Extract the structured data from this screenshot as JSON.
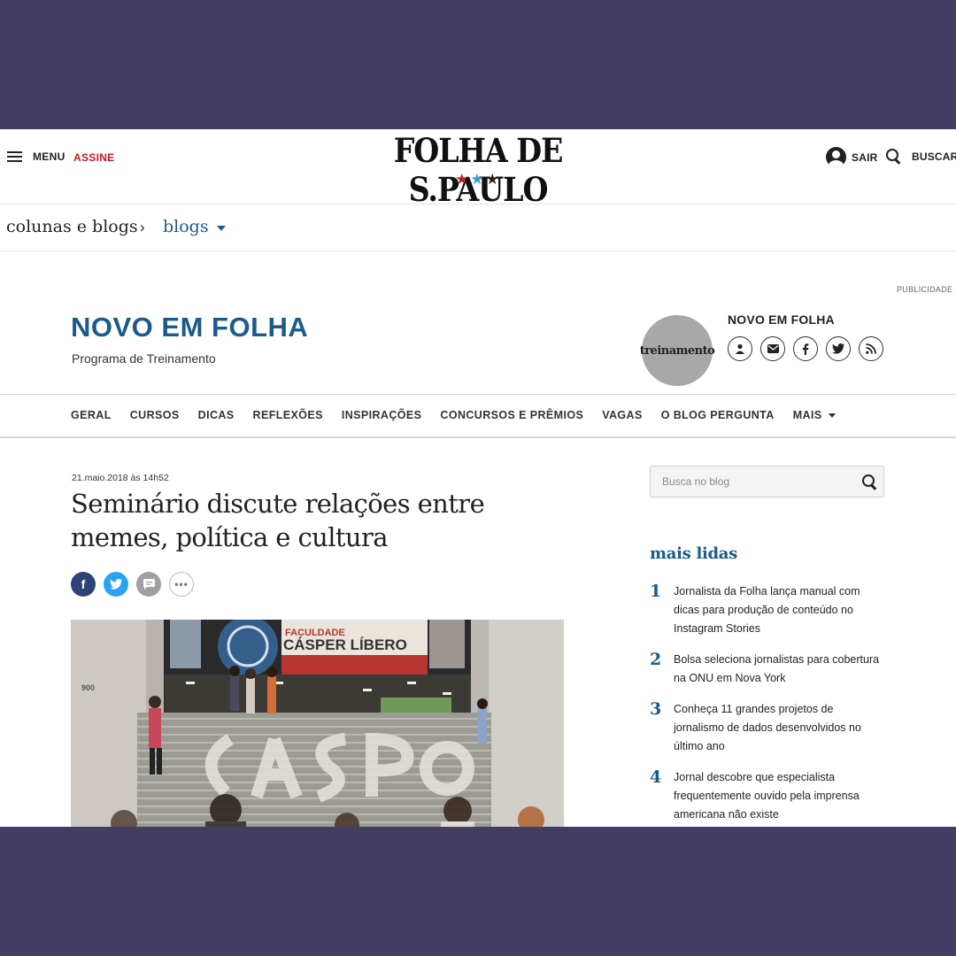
{
  "header": {
    "menu_label": "MENU",
    "subscribe_label": "ASSINE",
    "logo_text": "FOLHA DE S.PAULO",
    "logout_label": "SAIR",
    "search_label": "BUSCAR"
  },
  "breadcrumb": {
    "section": "colunas e blogs",
    "current": "blogs"
  },
  "ad_label": "PUBLICIDADE",
  "blog": {
    "title": "NOVO EM FOLHA",
    "subtitle": "Programa de Treinamento",
    "avatar_text": "treinamento",
    "side_name": "NOVO EM FOLHA",
    "social": [
      "person-icon",
      "mail-icon",
      "facebook-icon",
      "twitter-icon",
      "rss-icon"
    ]
  },
  "nav": {
    "items": [
      "GERAL",
      "CURSOS",
      "DICAS",
      "REFLEXÕES",
      "INSPIRAÇÕES",
      "CONCURSOS E PRÊMIOS",
      "VAGAS",
      "O BLOG PERGUNTA"
    ],
    "more_label": "MAIS"
  },
  "article": {
    "date": "21.maio.2018 às 14h52",
    "headline": "Seminário discute relações entre memes, política e cultura",
    "share_fb": "f",
    "photo": {
      "sign_top": "FACULDADE",
      "sign_name": "CÁSPER LÍBERO",
      "building_number": "900"
    }
  },
  "sidebar": {
    "search_placeholder": "Busca no blog",
    "most_read_title": "mais lidas",
    "most_read": [
      {
        "rank": "1",
        "text": "Jornalista da Folha lança manual com dicas para produção de conteúdo no Instagram Stories"
      },
      {
        "rank": "2",
        "text": "Bolsa seleciona jornalistas para cobertura na ONU em Nova York"
      },
      {
        "rank": "3",
        "text": "Conheça 11 grandes projetos de jornalismo de dados desenvolvidos no último ano"
      },
      {
        "rank": "4",
        "text": "Jornal descobre que especialista frequentemente ouvido pela imprensa americana não existe"
      }
    ]
  },
  "colors": {
    "frame": "#443d63",
    "brand_blue": "#1b5b8c",
    "subscribe_red": "#c31b25",
    "facebook": "#2d4378",
    "twitter": "#2aa3ef"
  }
}
